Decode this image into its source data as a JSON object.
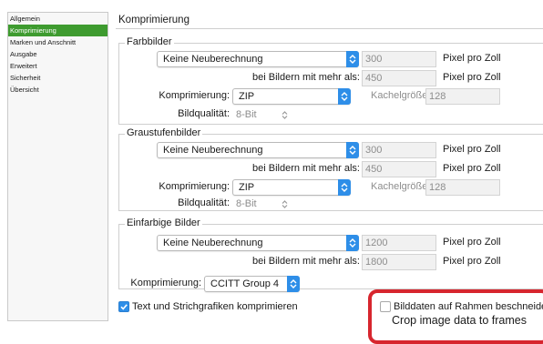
{
  "sidebar": {
    "items": [
      {
        "label": "Allgemein",
        "active": false
      },
      {
        "label": "Komprimierung",
        "active": true
      },
      {
        "label": "Marken und Anschnitt",
        "active": false
      },
      {
        "label": "Ausgabe",
        "active": false
      },
      {
        "label": "Erweitert",
        "active": false
      },
      {
        "label": "Sicherheit",
        "active": false
      },
      {
        "label": "Übersicht",
        "active": false
      }
    ]
  },
  "page_title": "Komprimierung",
  "groups": {
    "farbbilder": {
      "legend": "Farbbilder",
      "resample": "Keine Neuberechnung",
      "resample_ppi": "300",
      "unit1": "Pixel pro Zoll",
      "threshold_label": "bei Bildern mit mehr als:",
      "threshold_ppi": "450",
      "unit2": "Pixel pro Zoll",
      "compression_label": "Komprimierung:",
      "compression": "ZIP",
      "tile_label": "Kachelgröße:",
      "tile_value": "128",
      "quality_label": "Bildqualität:",
      "quality": "8-Bit"
    },
    "graustufen": {
      "legend": "Graustufenbilder",
      "resample": "Keine Neuberechnung",
      "resample_ppi": "300",
      "unit1": "Pixel pro Zoll",
      "threshold_label": "bei Bildern mit mehr als:",
      "threshold_ppi": "450",
      "unit2": "Pixel pro Zoll",
      "compression_label": "Komprimierung:",
      "compression": "ZIP",
      "tile_label": "Kachelgröße:",
      "tile_value": "128",
      "quality_label": "Bildqualität:",
      "quality": "8-Bit"
    },
    "einfarbig": {
      "legend": "Einfarbige Bilder",
      "resample": "Keine Neuberechnung",
      "resample_ppi": "1200",
      "unit1": "Pixel pro Zoll",
      "threshold_label": "bei Bildern mit mehr als:",
      "threshold_ppi": "1800",
      "unit2": "Pixel pro Zoll",
      "compression_label": "Komprimierung:",
      "compression": "CCITT Group 4"
    }
  },
  "options": {
    "compress_text_label": "Text und Strichgrafiken komprimieren",
    "compress_text_checked": true,
    "crop_frames_label": "Bilddaten auf Rahmen beschneiden",
    "crop_frames_checked": false
  },
  "annotation": {
    "caption": "Crop image data to frames",
    "color": "#d7262e"
  },
  "colors": {
    "accent": "#2e8ee8",
    "sidebar_active": "#3e9b2f"
  }
}
